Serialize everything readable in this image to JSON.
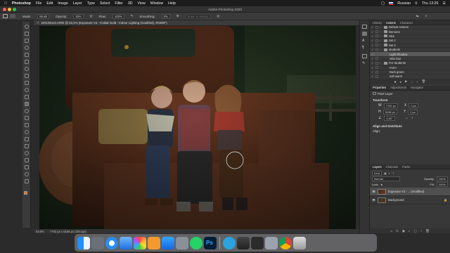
{
  "menubar": {
    "apple": "",
    "app_name": "Photoshop",
    "items": [
      "File",
      "Edit",
      "Image",
      "Layer",
      "Type",
      "Select",
      "Filter",
      "3D",
      "View",
      "Window",
      "Help"
    ],
    "language": "Russian",
    "clock": "Thu 13:26"
  },
  "window": {
    "title": "Adobe Photoshop 2020"
  },
  "options_bar": {
    "mode_label": "Mode:",
    "mode_value": "Brush",
    "opacity_label": "Opacity:",
    "opacity_value": "30%",
    "flow_label": "Flow:",
    "flow_value": "100%",
    "smoothing_label": "Smoothing:",
    "smoothing_value": "0%",
    "erase_history": "Erase to History"
  },
  "document": {
    "tab_title": "DSC09113.ARW @ 53,1% (Exposure V3 - Kodak Gold - Indoor Lighting (modified), RGB/8*)",
    "zoom": "53,6%",
    "doc_size": "7792 px x 5196 px (300 ppi)"
  },
  "actions_panel": {
    "tabs": [
      "History",
      "Actions",
      "Character"
    ],
    "active_tab": "Actions",
    "items": [
      {
        "label": "Default Actions",
        "type": "set"
      },
      {
        "label": "Demons",
        "type": "set"
      },
      {
        "label": "Skin",
        "type": "set"
      },
      {
        "label": "Set 1",
        "type": "set"
      },
      {
        "label": "Set 2",
        "type": "set"
      },
      {
        "label": "students",
        "type": "set"
      },
      {
        "label": "Light Shadow",
        "type": "action",
        "selected": true
      },
      {
        "label": "Skin blur",
        "type": "action"
      },
      {
        "label": "For Students",
        "type": "set"
      },
      {
        "label": "Form",
        "type": "action"
      },
      {
        "label": "Dark green",
        "type": "action"
      },
      {
        "label": "soft warm",
        "type": "action"
      }
    ]
  },
  "properties_panel": {
    "tabs": [
      "Properties",
      "Adjustments",
      "Navigator"
    ],
    "layer_type": "Pixel Layer",
    "transform_label": "Transform",
    "w_label": "W",
    "w_value": "7792 px",
    "h_label": "H",
    "h_value": "5196 px",
    "x_label": "X",
    "x_value": "0 px",
    "y_label": "Y",
    "y_value": "0 px",
    "angle_value": "0,00°",
    "align_label": "Align and Distribute",
    "align_sub": "Align:"
  },
  "layers_panel": {
    "tabs": [
      "Layers",
      "Channels",
      "Paths"
    ],
    "kind_label": "Kind",
    "blend_mode": "Normal",
    "opacity_label": "Opacity:",
    "opacity_value": "100%",
    "lock_label": "Lock:",
    "fill_label": "Fill:",
    "fill_value": "100%",
    "layers": [
      {
        "name": "Exposure V3 - ... (modified)",
        "selected": true
      },
      {
        "name": "Background",
        "selected": false
      }
    ]
  },
  "dock": {
    "icons": [
      "finder-icon",
      "launchpad-icon",
      "safari-icon",
      "mail-icon",
      "photos-icon",
      "books-icon",
      "app-store-icon",
      "system-preferences-icon",
      "whatsapp-icon",
      "photoshop-icon",
      "separator",
      "telegram-icon",
      "keynote-icon",
      "quicktime-icon",
      "monitor-icon",
      "chrome-icon",
      "trash-icon"
    ],
    "photoshop_label": "Ps"
  },
  "colors": {
    "accent": "#2f7de1",
    "foreground_swatch": "#e8731e",
    "background_swatch": "#ffffff"
  }
}
